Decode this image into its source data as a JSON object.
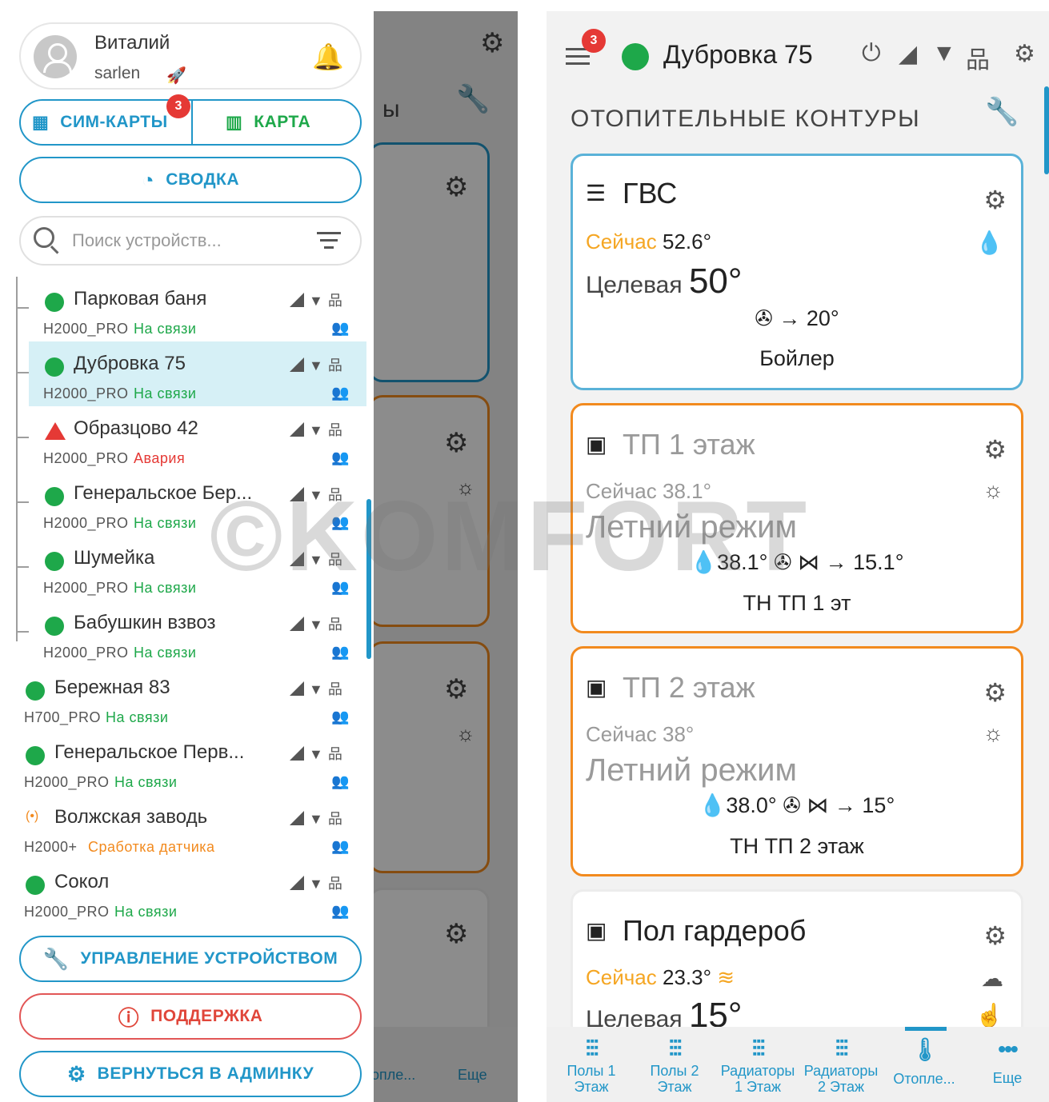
{
  "left": {
    "user": {
      "name": "Виталий",
      "login": "sarlen"
    },
    "buttons": {
      "sim_label": "СИМ-КАРТЫ",
      "sim_badge": "3",
      "map_label": "КАРТА",
      "summary_label": "СВОДКА",
      "manage_label": "УПРАВЛЕНИЕ УСТРОЙСТВОМ",
      "support_label": "ПОДДЕРЖКА",
      "admin_label": "ВЕРНУТЬСЯ В АДМИНКУ"
    },
    "search": {
      "placeholder": "Поиск устройств..."
    },
    "devices": [
      {
        "name": "Парковая баня",
        "model": "H2000_PRO",
        "state": "На связи",
        "status": "ok"
      },
      {
        "name": "Дубровка 75",
        "model": "H2000_PRO",
        "state": "На связи",
        "status": "ok",
        "selected": true
      },
      {
        "name": "Образцово 42",
        "model": "H2000_PRO",
        "state": "Авария",
        "status": "alarm"
      },
      {
        "name": "Генеральское Бер...",
        "model": "H2000_PRO",
        "state": "На связи",
        "status": "ok"
      },
      {
        "name": "Шумейка",
        "model": "H2000_PRO",
        "state": "На связи",
        "status": "ok"
      },
      {
        "name": "Бабушкин взвоз",
        "model": "H2000_PRO",
        "state": "На связи",
        "status": "ok"
      },
      {
        "name": "Бережная 83",
        "model": "H700_PRO",
        "state": "На связи",
        "status": "ok"
      },
      {
        "name": "Генеральское Перв...",
        "model": "H2000_PRO",
        "state": "На связи",
        "status": "ok"
      },
      {
        "name": "Волжская заводь",
        "model": "H2000+",
        "state": "Сработка датчика",
        "status": "warn"
      },
      {
        "name": "Сокол",
        "model": "H2000_PRO",
        "state": "На связи",
        "status": "ok"
      }
    ],
    "bg_partial": {
      "section_tail": "ы",
      "nav_heating": "опле...",
      "nav_more": "Еще"
    }
  },
  "right": {
    "header": {
      "menu_badge": "3",
      "device_name": "Дубровка 75"
    },
    "section_title": "ОТОПИТЕЛЬНЫЕ КОНТУРЫ",
    "cards": {
      "gvs": {
        "title": "ГВС",
        "now_label": "Сейчас",
        "now_value": "52.6°",
        "target_label": "Целевая",
        "target_value": "50°",
        "flow": "→ 20°",
        "source": "Бойлер"
      },
      "tp1": {
        "title": "ТП 1 этаж",
        "now_label": "Сейчас",
        "now_value": "38.1°",
        "mode": "Летний режим",
        "drop_value": "38.1°",
        "flow": "→ 15.1°",
        "source": "ТН ТП 1 эт"
      },
      "tp2": {
        "title": "ТП 2 этаж",
        "now_label": "Сейчас",
        "now_value": "38°",
        "mode": "Летний режим",
        "drop_value": "38.0°",
        "flow": "→ 15°",
        "source": "ТН ТП 2 этаж"
      },
      "wardrobe": {
        "title": "Пол гардероб",
        "now_label": "Сейчас",
        "now_value": "23.3°",
        "target_label": "Целевая",
        "target_value": "15°"
      }
    },
    "nav": [
      {
        "line1": "Полы 1",
        "line2": "Этаж"
      },
      {
        "line1": "Полы 2",
        "line2": "Этаж"
      },
      {
        "line1": "Радиаторы",
        "line2": "1 Этаж"
      },
      {
        "line1": "Радиаторы",
        "line2": "2 Этаж"
      },
      {
        "line1": "Отопле...",
        "line2": ""
      },
      {
        "line1": "Еще",
        "line2": ""
      }
    ]
  },
  "watermark": "©KOMFORT",
  "colors": {
    "accent": "#2196c8",
    "online": "#1ea84a",
    "alarm": "#e53935",
    "warning": "#f28a1e",
    "now_label": "#f5a623"
  }
}
